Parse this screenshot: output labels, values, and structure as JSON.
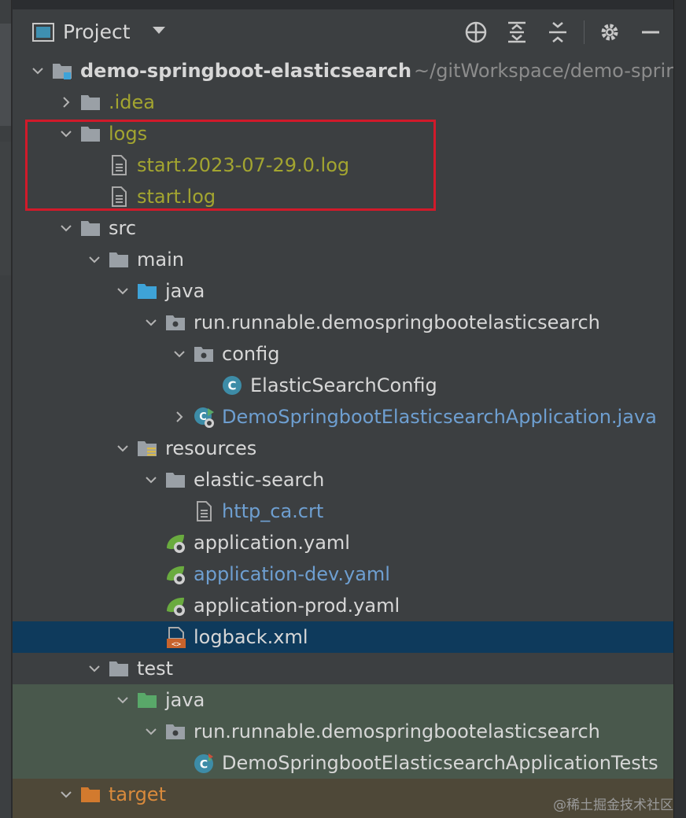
{
  "header": {
    "title": "Project",
    "icons": [
      "project-view-icon",
      "locate-icon",
      "expand-all-icon",
      "collapse-all-icon",
      "gear-icon",
      "minimize-icon"
    ]
  },
  "tree": {
    "root": {
      "name": "demo-springboot-elasticsearch",
      "path": "~/gitWorkspace/demo-sprir"
    },
    "idea": ".idea",
    "logs": ".logs",
    "logs_label": "logs",
    "log1": "start.2023-07-29.0.log",
    "log2": "start.log",
    "src": "src",
    "main": "main",
    "java": "java",
    "pkg": "run.runnable.demospringbootelasticsearch",
    "config": "config",
    "es_config": "ElasticSearchConfig",
    "app_class": "DemoSpringbootElasticsearchApplication.java",
    "resources": "resources",
    "elastic_search": "elastic-search",
    "http_ca": "http_ca.crt",
    "app_yaml": "application.yaml",
    "app_dev": "application-dev.yaml",
    "app_prod": "application-prod.yaml",
    "logback": "logback.xml",
    "test": "test",
    "test_java": "java",
    "test_pkg": "run.runnable.demospringbootelasticsearch",
    "test_class": "DemoSpringbootElasticsearchApplicationTests",
    "target": "target"
  },
  "watermark": "@稀土掘金技术社区",
  "colors": {
    "background": "#3c3f41",
    "selected": "#0e3a5c",
    "test_bg": "#49584c",
    "excluded_bg": "#4e4838",
    "highlight_box": "#d11a2a",
    "ignored_text": "#a3a530",
    "modified_text": "#6e9fd1"
  }
}
